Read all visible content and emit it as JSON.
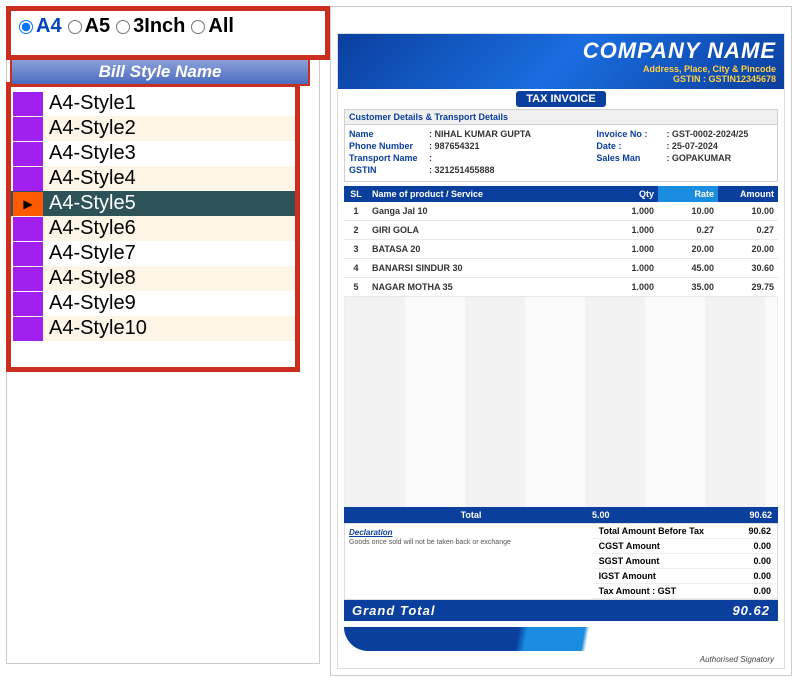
{
  "radios": {
    "a4": "A4",
    "a5": "A5",
    "inch3": "3Inch",
    "all": "All",
    "selected": "a4"
  },
  "header": {
    "bill_style_name": "Bill Style Name"
  },
  "styles": [
    {
      "label": "A4-Style1",
      "selected": false
    },
    {
      "label": "A4-Style2",
      "selected": false
    },
    {
      "label": "A4-Style3",
      "selected": false
    },
    {
      "label": "A4-Style4",
      "selected": false
    },
    {
      "label": "A4-Style5",
      "selected": true
    },
    {
      "label": "A4-Style6",
      "selected": false
    },
    {
      "label": "A4-Style7",
      "selected": false
    },
    {
      "label": "A4-Style8",
      "selected": false
    },
    {
      "label": "A4-Style9",
      "selected": false
    },
    {
      "label": "A4-Style10",
      "selected": false
    }
  ],
  "invoice": {
    "company_name": "COMPANY NAME",
    "address_line": "Address, Place, City & Pincode",
    "gstin_label": "GSTIN : GSTIN12345678",
    "badge": "TAX INVOICE",
    "cust_head": "Customer Details & Transport Details",
    "customer": {
      "name_lbl": "Name",
      "name_val": ": NIHAL KUMAR GUPTA",
      "phone_lbl": "Phone Number",
      "phone_val": ": 987654321",
      "trans_lbl": "Transport Name",
      "trans_val": ":",
      "gstin_lbl": "GSTIN",
      "gstin_val": ": 321251455888"
    },
    "meta": {
      "invno_lbl": "Invoice No :",
      "invno_val": ": GST-0002-2024/25",
      "date_lbl": "Date :",
      "date_val": ": 25-07-2024",
      "sales_lbl": "Sales Man",
      "sales_val": ": GOPAKUMAR"
    },
    "columns": {
      "sl": "SL",
      "name": "Name of product / Service",
      "qty": "Qty",
      "rate": "Rate",
      "amount": "Amount"
    },
    "items": [
      {
        "sl": "1",
        "name": "Ganga Jal 10",
        "qty": "1.000",
        "rate": "10.00",
        "amt": "10.00"
      },
      {
        "sl": "2",
        "name": "GIRI GOLA",
        "qty": "1.000",
        "rate": "0.27",
        "amt": "0.27"
      },
      {
        "sl": "3",
        "name": "BATASA 20",
        "qty": "1.000",
        "rate": "20.00",
        "amt": "20.00"
      },
      {
        "sl": "4",
        "name": "BANARSI SINDUR 30",
        "qty": "1.000",
        "rate": "45.00",
        "amt": "30.60"
      },
      {
        "sl": "5",
        "name": "NAGAR MOTHA 35",
        "qty": "1.000",
        "rate": "35.00",
        "amt": "29.75"
      }
    ],
    "total": {
      "label": "Total",
      "qty": "5.00",
      "amount": "90.62"
    },
    "declaration": {
      "title": "Declaration",
      "text": "Goods once sold will not be taken back or exchange"
    },
    "taxes": {
      "before_lbl": "Total Amount Before Tax",
      "before_val": "90.62",
      "cgst_lbl": "CGST Amount",
      "cgst_val": "0.00",
      "sgst_lbl": "SGST Amount",
      "sgst_val": "0.00",
      "igst_lbl": "IGST Amount",
      "igst_val": "0.00",
      "taxgst_lbl": "Tax Amount : GST",
      "taxgst_val": "0.00"
    },
    "grand": {
      "label": "Grand  Total",
      "value": "90.62"
    },
    "signatory": "Authorised Signatory"
  }
}
